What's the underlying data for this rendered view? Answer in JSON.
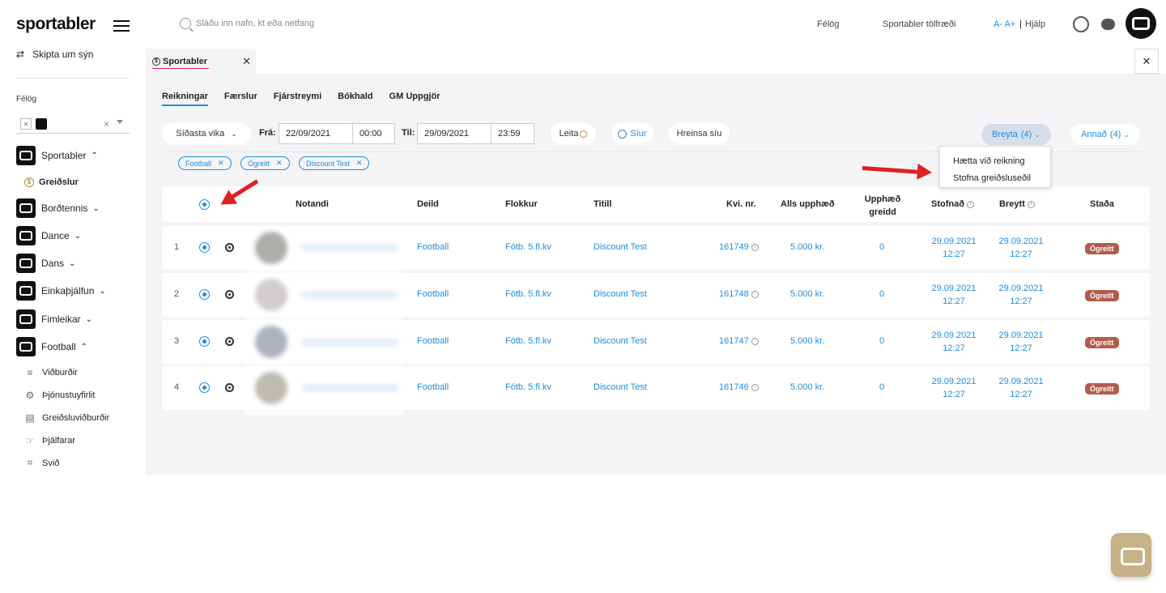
{
  "sidebar": {
    "brand": "sportabler",
    "switch_view": "Skipta um sýn",
    "felog_label": "Félög",
    "felog_chip_x": "×",
    "felog_clear": "×",
    "items": [
      {
        "label": "Sportabler",
        "chevron": "⌃"
      },
      {
        "label": "Greiðslur"
      },
      {
        "label": "Borðtennis",
        "chevron": "⌄"
      },
      {
        "label": "Dance",
        "chevron": "⌄"
      },
      {
        "label": "Dans",
        "chevron": "⌄"
      },
      {
        "label": "Einkaþjálfun",
        "chevron": "⌄"
      },
      {
        "label": "Fimleikar",
        "chevron": "⌄"
      },
      {
        "label": "Football",
        "chevron": "⌃"
      }
    ],
    "subitems": [
      {
        "label": "Viðburðir",
        "icon": "≡"
      },
      {
        "label": "Þjónustuyfirlit",
        "icon": "⚙"
      },
      {
        "label": "Greiðsluviðburðir",
        "icon": "▤"
      },
      {
        "label": "Þjálfarar",
        "icon": "☞"
      },
      {
        "label": "Svið",
        "icon": "⌗"
      }
    ]
  },
  "topbar": {
    "search_placeholder": "Sláðu inn nafn, kt eða netfang",
    "felog": "Félög",
    "stats": "Sportabler tölfræði",
    "font_size": "A- A+",
    "separator": "|",
    "help": "Hjálp"
  },
  "tab": {
    "coin": "$",
    "label": "Sportabler",
    "close": "✕",
    "close_all": "✕"
  },
  "subnav": [
    "Reikningar",
    "Færslur",
    "Fjárstreymi",
    "Bókhald",
    "GM Uppgjör"
  ],
  "filters": {
    "period": "Síðasta vika",
    "from_label": "Frá:",
    "from_date": "22/09/2021",
    "from_time": "00:00",
    "to_label": "Til:",
    "to_date": "29/09/2021",
    "to_time": "23:59",
    "search": "Leita",
    "filters": "Síur",
    "clear": "Hreinsa síu",
    "breyta": "Breyta",
    "breyta_count": "(4)",
    "annad": "Annað",
    "annad_count": "(4)"
  },
  "dropdown": [
    "Hætta við reikning",
    "Stofna greiðsluseðil"
  ],
  "tags": [
    "Football",
    "Ógreitt",
    "Discount Test"
  ],
  "columns": {
    "notandi": "Notandi",
    "deild": "Deild",
    "flokkur": "Flokkur",
    "titill": "Titill",
    "kvi": "Kvi. nr.",
    "alls": "Alls upphæð",
    "upphaed1": "Upphæð",
    "upphaed2": "greidd",
    "stofnad": "Stofnað",
    "breytt": "Breytt",
    "stada": "Staða"
  },
  "rows": [
    {
      "n": "1",
      "deild": "Football",
      "flokkur": "Fótb. 5.fl.kv",
      "titill": "Discount Test",
      "kvi": "161749",
      "alls": "5.000 kr.",
      "greidd": "0",
      "stofnad_d": "29.09.2021",
      "stofnad_t": "12:27",
      "breytt_d": "29.09.2021",
      "breytt_t": "12:27",
      "stada": "Ógreitt",
      "avatar_color": "#4c4a3c"
    },
    {
      "n": "2",
      "deild": "Football",
      "flokkur": "Fótb. 5.fl.kv",
      "titill": "Discount Test",
      "kvi": "161748",
      "alls": "5.000 kr.",
      "greidd": "0",
      "stofnad_d": "29.09.2021",
      "stofnad_t": "12:27",
      "breytt_d": "29.09.2021",
      "breytt_t": "12:27",
      "stada": "Ógreitt",
      "avatar_color": "#9a9090"
    },
    {
      "n": "3",
      "deild": "Football",
      "flokkur": "Fótb. 5.fl.kv",
      "titill": "Discount Test",
      "kvi": "161747",
      "alls": "5.000 kr.",
      "greidd": "0",
      "stofnad_d": "29.09.2021",
      "stofnad_t": "12:27",
      "breytt_d": "29.09.2021",
      "breytt_t": "12:27",
      "stada": "Ógreitt",
      "avatar_color": "#4a5670"
    },
    {
      "n": "4",
      "deild": "Football",
      "flokkur": "Fótb. 5.fl.kv",
      "titill": "Discount Test",
      "kvi": "161746",
      "alls": "5.000 kr.",
      "greidd": "0",
      "stofnad_d": "29.09.2021",
      "stofnad_t": "12:27",
      "breytt_d": "29.09.2021",
      "breytt_t": "12:27",
      "stada": "Ógreitt",
      "avatar_color": "#6f6a50"
    }
  ],
  "colors": {
    "accent": "#1f8ce0",
    "badge": "#b25b4c",
    "annotation": "#e02020"
  }
}
